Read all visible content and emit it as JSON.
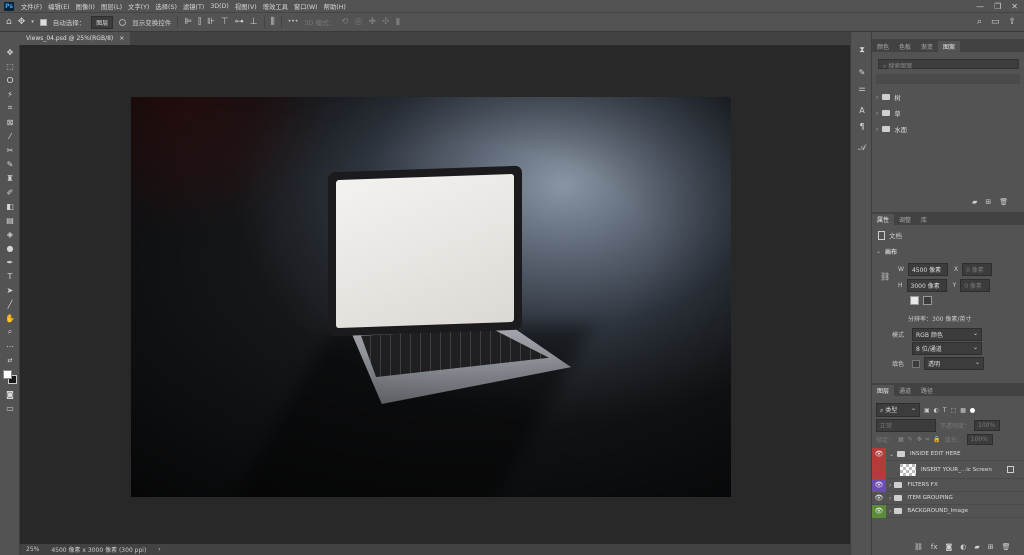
{
  "menubar": {
    "logo": "Ps",
    "items": [
      "文件(F)",
      "编辑(E)",
      "图像(I)",
      "图层(L)",
      "文字(Y)",
      "选择(S)",
      "滤镜(T)",
      "3D(D)",
      "视图(V)",
      "增效工具",
      "窗口(W)",
      "帮助(H)"
    ],
    "minimize": "—",
    "maximize": "❐",
    "close": "✕"
  },
  "options": {
    "auto_select_label": "自动选择：",
    "auto_select_value": "图层",
    "show_transform_label": "显示变换控件",
    "mode_3d_label": "3D 模式：",
    "more": "•••"
  },
  "document": {
    "tab_title": "Views_04.psd @ 25%(RGB/8)",
    "tab_close": "×"
  },
  "statusbar": {
    "zoom": "25%",
    "info": "4500 像素 x 3000 像素 (300 ppi)",
    "arrow": "›"
  },
  "panel_top": {
    "tabs": [
      "颜色",
      "色板",
      "渐变",
      "图案"
    ],
    "search_placeholder": "搜索图案",
    "folders": [
      "树",
      "草",
      "水面"
    ]
  },
  "properties": {
    "tabs": [
      "属性",
      "调整",
      "库"
    ],
    "doc_label": "文档",
    "canvas_label": "画布",
    "w_label": "W",
    "w_value": "4500 像素",
    "x_label": "X",
    "x_value": "0 像素",
    "h_label": "H",
    "h_value": "3000 像素",
    "y_label": "Y",
    "y_value": "0 像素",
    "resolution": "分辨率：300 像素/英寸",
    "mode_label": "模式",
    "mode_value": "RGB 颜色",
    "depth_value": "8 位/通道",
    "fill_label": "填色",
    "fill_value": "透明"
  },
  "layers": {
    "tabs": [
      "图层",
      "通道",
      "路径"
    ],
    "filter_kind": "类型",
    "blend_mode": "正常",
    "opacity_label": "不透明度：",
    "opacity_value": "100%",
    "lock_label": "锁定：",
    "fill_label": "填充：",
    "fill_value": "100%",
    "items": [
      {
        "name": "INSIDE EDIT HERE",
        "color": "#b53a3a",
        "kind": "folder-open"
      },
      {
        "name": "INSERT YOUR_...ic Screen",
        "color": "#b53a3a",
        "kind": "smart"
      },
      {
        "name": "FILTERS  FX",
        "color": "#6a4fb0",
        "kind": "folder"
      },
      {
        "name": "ITEM GROUPING",
        "color": "#535353",
        "kind": "folder"
      },
      {
        "name": "BACKGROUND_Image",
        "color": "#5a8a3a",
        "kind": "folder"
      }
    ]
  }
}
